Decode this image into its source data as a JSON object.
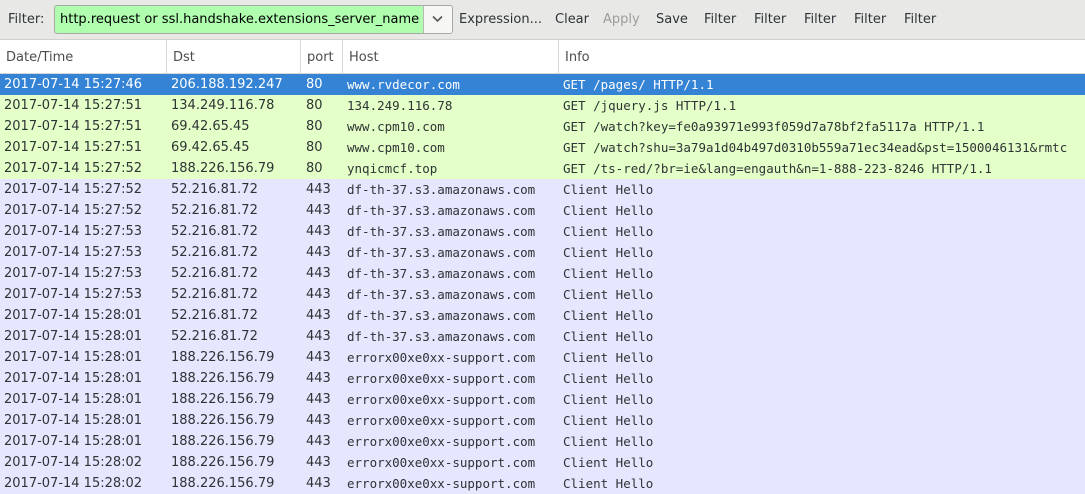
{
  "toolbar": {
    "filter_label": "Filter:",
    "filter_value": "http.request or ssl.handshake.extensions_server_name",
    "expression_label": "Expression...",
    "clear_label": "Clear",
    "apply_label": "Apply",
    "save_label": "Save",
    "filter_buttons": [
      "Filter",
      "Filter",
      "Filter",
      "Filter",
      "Filter"
    ]
  },
  "columns": {
    "date": "Date/Time",
    "dst": "Dst",
    "port": "port",
    "host": "Host",
    "info": "Info"
  },
  "colors": {
    "http_row": "#e4ffc7",
    "tls_row": "#e7e6ff",
    "selected_row": "#3583d5",
    "filter_valid": "#afffaf"
  },
  "packets": [
    {
      "time": "2017-07-14 15:27:46",
      "dst": "206.188.192.247",
      "port": "80",
      "host": "www.rvdecor.com",
      "info": "GET /pages/ HTTP/1.1",
      "kind": "http",
      "selected": true
    },
    {
      "time": "2017-07-14 15:27:51",
      "dst": "134.249.116.78",
      "port": "80",
      "host": "134.249.116.78",
      "info": "GET /jquery.js HTTP/1.1",
      "kind": "http"
    },
    {
      "time": "2017-07-14 15:27:51",
      "dst": "69.42.65.45",
      "port": "80",
      "host": "www.cpm10.com",
      "info": "GET /watch?key=fe0a93971e993f059d7a78bf2fa5117a HTTP/1.1",
      "kind": "http"
    },
    {
      "time": "2017-07-14 15:27:51",
      "dst": "69.42.65.45",
      "port": "80",
      "host": "www.cpm10.com",
      "info": "GET /watch?shu=3a79a1d04b497d0310b559a71ec34ead&pst=1500046131&rmtc",
      "kind": "http"
    },
    {
      "time": "2017-07-14 15:27:52",
      "dst": "188.226.156.79",
      "port": "80",
      "host": "ynqicmcf.top",
      "info": "GET /ts-red/?br=ie&lang=engauth&n=1-888-223-8246 HTTP/1.1",
      "kind": "http"
    },
    {
      "time": "2017-07-14 15:27:52",
      "dst": "52.216.81.72",
      "port": "443",
      "host": "df-th-37.s3.amazonaws.com",
      "info": "Client Hello",
      "kind": "tls"
    },
    {
      "time": "2017-07-14 15:27:52",
      "dst": "52.216.81.72",
      "port": "443",
      "host": "df-th-37.s3.amazonaws.com",
      "info": "Client Hello",
      "kind": "tls"
    },
    {
      "time": "2017-07-14 15:27:53",
      "dst": "52.216.81.72",
      "port": "443",
      "host": "df-th-37.s3.amazonaws.com",
      "info": "Client Hello",
      "kind": "tls"
    },
    {
      "time": "2017-07-14 15:27:53",
      "dst": "52.216.81.72",
      "port": "443",
      "host": "df-th-37.s3.amazonaws.com",
      "info": "Client Hello",
      "kind": "tls"
    },
    {
      "time": "2017-07-14 15:27:53",
      "dst": "52.216.81.72",
      "port": "443",
      "host": "df-th-37.s3.amazonaws.com",
      "info": "Client Hello",
      "kind": "tls"
    },
    {
      "time": "2017-07-14 15:27:53",
      "dst": "52.216.81.72",
      "port": "443",
      "host": "df-th-37.s3.amazonaws.com",
      "info": "Client Hello",
      "kind": "tls"
    },
    {
      "time": "2017-07-14 15:28:01",
      "dst": "52.216.81.72",
      "port": "443",
      "host": "df-th-37.s3.amazonaws.com",
      "info": "Client Hello",
      "kind": "tls"
    },
    {
      "time": "2017-07-14 15:28:01",
      "dst": "52.216.81.72",
      "port": "443",
      "host": "df-th-37.s3.amazonaws.com",
      "info": "Client Hello",
      "kind": "tls"
    },
    {
      "time": "2017-07-14 15:28:01",
      "dst": "188.226.156.79",
      "port": "443",
      "host": "errorx00xe0xx-support.com",
      "info": "Client Hello",
      "kind": "tls"
    },
    {
      "time": "2017-07-14 15:28:01",
      "dst": "188.226.156.79",
      "port": "443",
      "host": "errorx00xe0xx-support.com",
      "info": "Client Hello",
      "kind": "tls"
    },
    {
      "time": "2017-07-14 15:28:01",
      "dst": "188.226.156.79",
      "port": "443",
      "host": "errorx00xe0xx-support.com",
      "info": "Client Hello",
      "kind": "tls"
    },
    {
      "time": "2017-07-14 15:28:01",
      "dst": "188.226.156.79",
      "port": "443",
      "host": "errorx00xe0xx-support.com",
      "info": "Client Hello",
      "kind": "tls"
    },
    {
      "time": "2017-07-14 15:28:01",
      "dst": "188.226.156.79",
      "port": "443",
      "host": "errorx00xe0xx-support.com",
      "info": "Client Hello",
      "kind": "tls"
    },
    {
      "time": "2017-07-14 15:28:02",
      "dst": "188.226.156.79",
      "port": "443",
      "host": "errorx00xe0xx-support.com",
      "info": "Client Hello",
      "kind": "tls"
    },
    {
      "time": "2017-07-14 15:28:02",
      "dst": "188.226.156.79",
      "port": "443",
      "host": "errorx00xe0xx-support.com",
      "info": "Client Hello",
      "kind": "tls"
    }
  ]
}
